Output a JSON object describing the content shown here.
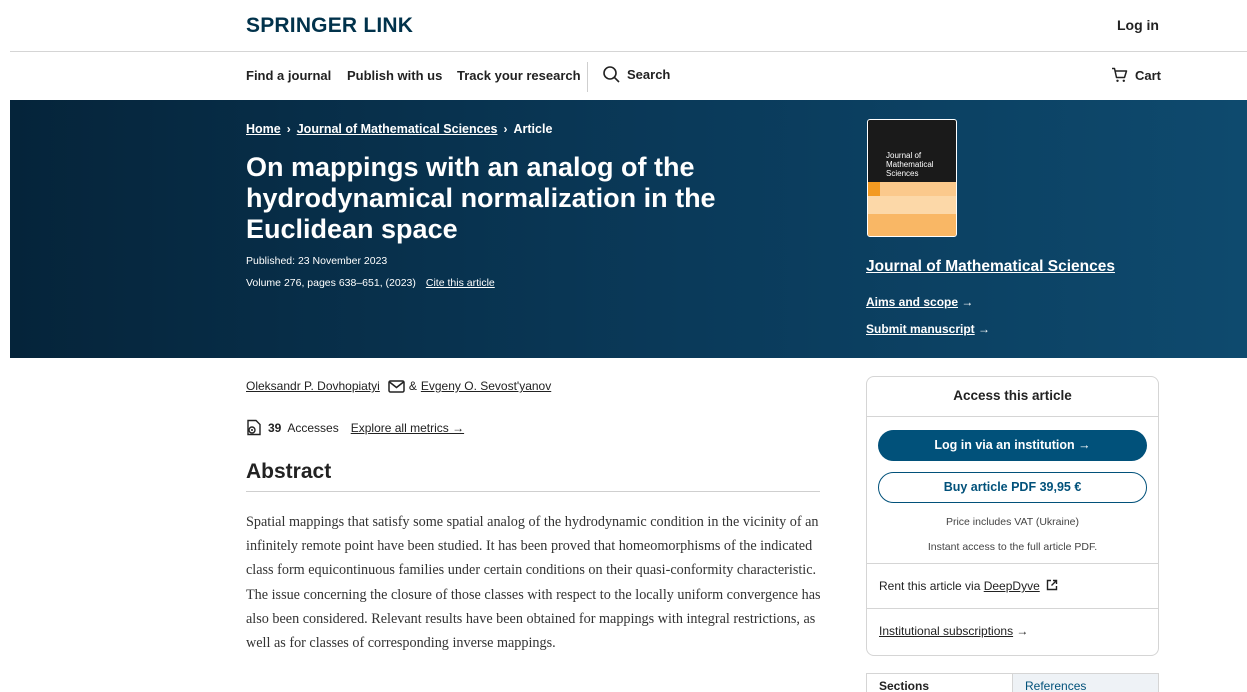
{
  "header": {
    "logo": "SPRINGER LINK",
    "login": "Log in"
  },
  "nav": {
    "items": [
      "Find a journal",
      "Publish with us",
      "Track your research"
    ],
    "search": "Search",
    "cart": "Cart"
  },
  "breadcrumb": {
    "home": "Home",
    "journal": "Journal of Mathematical Sciences",
    "current": "Article",
    "separator": "›"
  },
  "article": {
    "title": "On mappings with an analog of the hydrodynamical normalization in the Euclidean space",
    "published": "Published: 23 November 2023",
    "volume": "Volume 276, pages 638–651, (2023)",
    "cite": "Cite this article",
    "author1": "Oleksandr P. Dovhopiatyi",
    "author_sep": "&",
    "author2": "Evgeny O. Sevost'yanov",
    "accesses_count": "39",
    "accesses_label": "Accesses",
    "metrics_link": "Explore all metrics →",
    "abstract_heading": "Abstract",
    "abstract_text": "Spatial mappings that satisfy some spatial analog of the hydrodynamic condition in the vicinity of an infinitely remote point have been studied. It has been proved that homeomorphisms of the indicated class form equicontinuous families under certain conditions on their quasi-conformity characteristic. The issue concerning the closure of those classes with respect to the locally uniform convergence has also been considered. Relevant results have been obtained for mappings with integral restrictions, as well as for classes of corresponding inverse mappings."
  },
  "journal": {
    "cover_title": "Journal of Mathematical Sciences",
    "name": "Journal of Mathematical Sciences",
    "aims": "Aims and scope",
    "submit": "Submit manuscript",
    "arrow": "→"
  },
  "access": {
    "heading": "Access this article",
    "login_institution": "Log in via an institution →",
    "buy": "Buy article PDF 39,95 €",
    "vat": "Price includes VAT (Ukraine)",
    "instant": "Instant access to the full article PDF.",
    "rent_prefix": "Rent this article via ",
    "rent_link": "DeepDyve",
    "subscriptions": "Institutional subscriptions",
    "arrow": "→"
  },
  "tabs": {
    "sections": "Sections",
    "references": "References"
  },
  "colors": {
    "brand": "#01324b",
    "hero": "#0a3a5a",
    "button": "#01517a"
  }
}
